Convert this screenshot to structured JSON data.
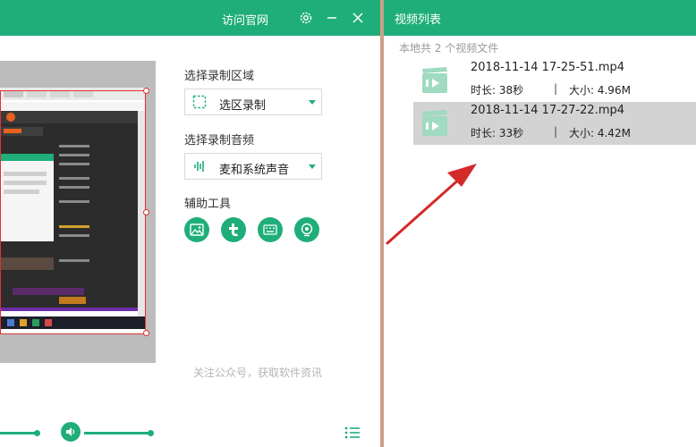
{
  "app": {
    "title_link": "访问官网",
    "colors": {
      "accent": "#1fae7a",
      "frame": "#e03131",
      "selected_row": "#d3d3d3"
    }
  },
  "settings": {
    "record_area_label": "选择录制区域",
    "record_area_value": "选区录制",
    "record_audio_label": "选择录制音频",
    "record_audio_value": "麦和系统声音",
    "tools_label": "辅助工具",
    "tools": [
      {
        "name": "image-tool",
        "icon": "image-icon"
      },
      {
        "name": "text-tool",
        "icon": "t-letter-icon"
      },
      {
        "name": "subtitle-tool",
        "icon": "keyboard-icon"
      },
      {
        "name": "camera-tool",
        "icon": "webcam-icon"
      }
    ]
  },
  "footer": {
    "note": "关注公众号，获取软件资讯"
  },
  "video_list": {
    "title": "视频列表",
    "count_text": "本地共 2 个视频文件",
    "items": [
      {
        "filename": "2018-11-14 17-25-51.mp4",
        "duration": "时长: 38秒",
        "separator": "|",
        "size": "大小: 4.96M",
        "selected": false
      },
      {
        "filename": "2018-11-14 17-27-22.mp4",
        "duration": "时长: 33秒",
        "separator": "|",
        "size": "大小: 4.42M",
        "selected": true
      }
    ]
  }
}
